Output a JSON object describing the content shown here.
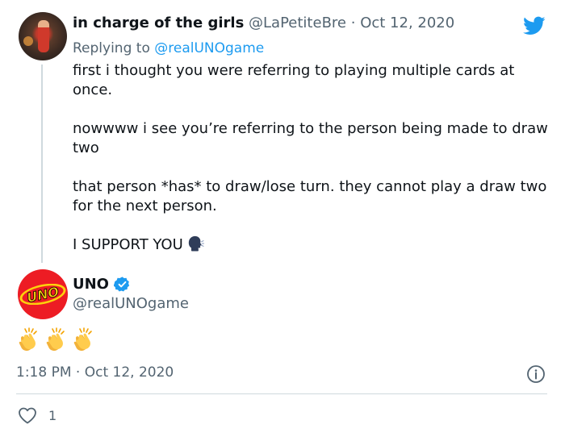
{
  "reply_tweet": {
    "display_name": "in charge of the girls",
    "handle": "@LaPetiteBre",
    "separator": "·",
    "date": "Oct 12, 2020",
    "replying_prefix": "Replying to",
    "replying_to": "@realUNOgame",
    "paragraphs": [
      "first i thought you were referring to playing multiple cards at once.",
      "nowwww i see you’re referring to the person being made to draw two",
      "that person *has* to draw/lose turn. they cannot play a draw two for the next person.",
      "I SUPPORT YOU"
    ],
    "emoji": "speaking-head-icon"
  },
  "main_tweet": {
    "display_name": "UNO",
    "handle": "@realUNOgame",
    "avatar_text": "UNO",
    "verified": true,
    "body_emoji": [
      "clapping-hands-icon",
      "clapping-hands-icon",
      "clapping-hands-icon"
    ],
    "time": "1:18 PM",
    "separator": "·",
    "date": "Oct 12, 2020"
  },
  "actions": {
    "like_count": "1"
  },
  "colors": {
    "brand_blue": "#1d9bf0",
    "secondary_text": "#536471",
    "uno_red": "#ed1c24",
    "uno_yellow": "#fcd20c"
  }
}
